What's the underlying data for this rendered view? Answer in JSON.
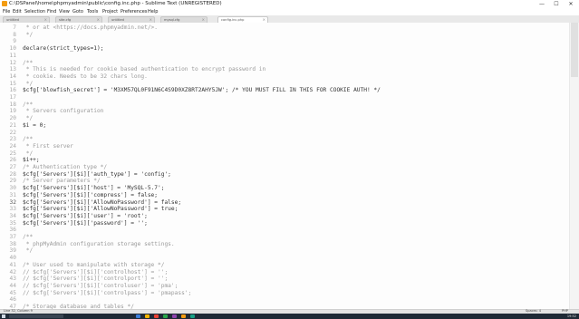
{
  "window": {
    "title": "C:\\DSPanel\\home\\phpmyadmin\\public\\config.inc.php - Sublime Text (UNREGISTERED)",
    "controls": [
      "—",
      "☐",
      "✕"
    ]
  },
  "menu": [
    "File",
    "Edit",
    "Selection",
    "Find",
    "View",
    "Goto",
    "Tools",
    "Project",
    "Preferences",
    "Help"
  ],
  "tabs": [
    {
      "label": "untitled",
      "active": false
    },
    {
      "label": "site.cfg",
      "active": false
    },
    {
      "label": "untitled",
      "active": false
    },
    {
      "label": "mysql.cfg",
      "active": false
    },
    {
      "label": "config.inc.php",
      "active": true
    }
  ],
  "editor": {
    "current_line": "32",
    "lines": [
      {
        "n": "7",
        "t": " * or at <https://docs.phpmyadmin.net/>.",
        "c": true
      },
      {
        "n": "8",
        "t": " */",
        "c": true
      },
      {
        "n": "9",
        "t": "",
        "c": false
      },
      {
        "n": "10",
        "t": "declare(strict_types=1);",
        "c": false
      },
      {
        "n": "11",
        "t": "",
        "c": false
      },
      {
        "n": "12",
        "t": "/**",
        "c": true
      },
      {
        "n": "13",
        "t": " * This is needed for cookie based authentication to encrypt password in",
        "c": true
      },
      {
        "n": "14",
        "t": " * cookie. Needs to be 32 chars long.",
        "c": true
      },
      {
        "n": "15",
        "t": " */",
        "c": true
      },
      {
        "n": "16",
        "t": "$cfg['blowfish_secret'] = 'M3XM57QL0F91N6C4S9D0XZ8RT2AHY5JW'; /* YOU MUST FILL IN THIS FOR COOKIE AUTH! */",
        "c": false
      },
      {
        "n": "17",
        "t": "",
        "c": false
      },
      {
        "n": "18",
        "t": "/**",
        "c": true
      },
      {
        "n": "19",
        "t": " * Servers configuration",
        "c": true
      },
      {
        "n": "20",
        "t": " */",
        "c": true
      },
      {
        "n": "21",
        "t": "$i = 0;",
        "c": false
      },
      {
        "n": "22",
        "t": "",
        "c": false
      },
      {
        "n": "23",
        "t": "/**",
        "c": true
      },
      {
        "n": "24",
        "t": " * First server",
        "c": true
      },
      {
        "n": "25",
        "t": " */",
        "c": true
      },
      {
        "n": "26",
        "t": "$i++;",
        "c": false
      },
      {
        "n": "27",
        "t": "/* Authentication type */",
        "c": true
      },
      {
        "n": "28",
        "t": "$cfg['Servers'][$i]['auth_type'] = 'config';",
        "c": false
      },
      {
        "n": "29",
        "t": "/* Server parameters */",
        "c": true
      },
      {
        "n": "30",
        "t": "$cfg['Servers'][$i]['host'] = 'MySQL-5.7';",
        "c": false
      },
      {
        "n": "31",
        "t": "$cfg['Servers'][$i]['compress'] = false;",
        "c": false
      },
      {
        "n": "32",
        "t": "$cfg['Servers'][$i]['AllowNoPassword'] = false;",
        "c": false
      },
      {
        "n": "33",
        "t": "$cfg['Servers'][$i]['AllowNoPassword'] = true;",
        "c": false
      },
      {
        "n": "34",
        "t": "$cfg['Servers'][$i]['user'] = 'root';",
        "c": false
      },
      {
        "n": "35",
        "t": "$cfg['Servers'][$i]['password'] = '';",
        "c": false
      },
      {
        "n": "36",
        "t": "",
        "c": false
      },
      {
        "n": "37",
        "t": "/**",
        "c": true
      },
      {
        "n": "38",
        "t": " * phpMyAdmin configuration storage settings.",
        "c": true
      },
      {
        "n": "39",
        "t": " */",
        "c": true
      },
      {
        "n": "40",
        "t": "",
        "c": false
      },
      {
        "n": "41",
        "t": "/* User used to manipulate with storage */",
        "c": true
      },
      {
        "n": "42",
        "t": "// $cfg['Servers'][$i]['controlhost'] = '';",
        "c": true
      },
      {
        "n": "43",
        "t": "// $cfg['Servers'][$i]['controlport'] = '';",
        "c": true
      },
      {
        "n": "44",
        "t": "// $cfg['Servers'][$i]['controluser'] = 'pma';",
        "c": true
      },
      {
        "n": "45",
        "t": "// $cfg['Servers'][$i]['controlpass'] = 'pmapass';",
        "c": true
      },
      {
        "n": "46",
        "t": "",
        "c": false
      },
      {
        "n": "47",
        "t": "/* Storage database and tables */",
        "c": true
      }
    ]
  },
  "status": {
    "position": "Line 32, Column 9",
    "tab_size": "Spaces: 4",
    "syntax": "PHP"
  },
  "taskbar": {
    "clock": "19:52",
    "app_colors": [
      "#3b7dd8",
      "#f4b400",
      "#e94235",
      "#2aa84a",
      "#8e44ad",
      "#f39c12",
      "#16a085"
    ]
  }
}
